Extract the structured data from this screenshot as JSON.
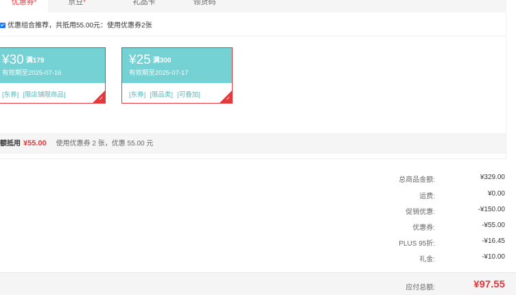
{
  "tabs": [
    {
      "label": "优惠券",
      "mark": "*",
      "active": true
    },
    {
      "label": "京豆",
      "mark": "*",
      "active": false
    },
    {
      "label": "礼品卡",
      "mark": "",
      "active": false
    },
    {
      "label": "领货码",
      "mark": "",
      "active": false
    }
  ],
  "coupon_panel": {
    "recommend_text": "优惠组合推荐，共抵用55.00元：使用优惠券2张",
    "coupons": [
      {
        "amount": "¥30",
        "condition": "满179",
        "valid": "有效期至2025-07-16",
        "tags": [
          "[东券]",
          "[限店铺限商品]"
        ]
      },
      {
        "amount": "¥25",
        "condition": "满300",
        "valid": "有效期至2025-07-17",
        "tags": [
          "[东券]",
          "[限品类]",
          "[可叠加]"
        ]
      }
    ],
    "summary_label": "金额抵用",
    "summary_amount": "¥55.00",
    "summary_desc": "使用优惠券 2 张，优惠 55.00 元"
  },
  "totals": [
    {
      "label": "总商品金额:",
      "value": "¥329.00"
    },
    {
      "label": "运费:",
      "value": "¥0.00"
    },
    {
      "label": "促销优惠:",
      "value": "-¥150.00"
    },
    {
      "label": "优惠券:",
      "value": "-¥55.00"
    },
    {
      "label": "PLUS 95折:",
      "value": "-¥16.45"
    },
    {
      "label": "礼金:",
      "value": "-¥10.00"
    }
  ],
  "payable": {
    "label": "应付总额:",
    "value": "¥97.55"
  },
  "colors": {
    "accent": "#e4393c",
    "coupon_bg": "#74d2d4",
    "tag_text": "#5bb6b8"
  }
}
